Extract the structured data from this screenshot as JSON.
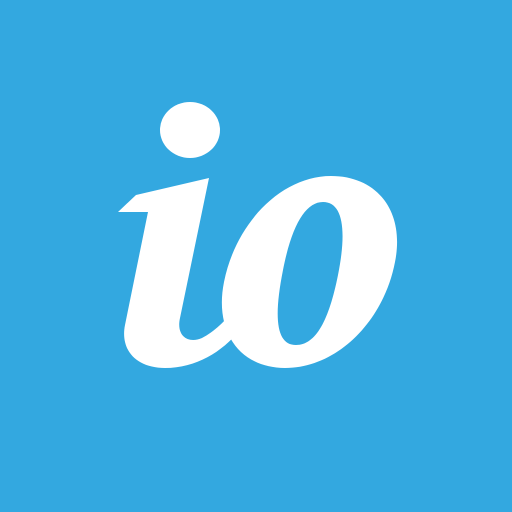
{
  "logo": {
    "icon_name": "io-logo-icon",
    "wordmark": "io",
    "background_color": "#33A8E0",
    "glyph_color": "#FFFFFF"
  }
}
